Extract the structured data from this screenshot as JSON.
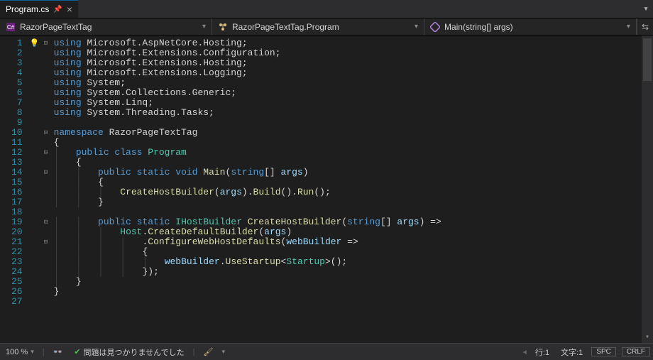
{
  "tab": {
    "name": "Program.cs"
  },
  "nav": {
    "project": "RazorPageTextTag",
    "class": "RazorPageTextTag.Program",
    "method": "Main(string[] args)"
  },
  "lines": {
    "count": 27,
    "bulb_line": 1,
    "folds": {
      "1": "⊟",
      "10": "⊟",
      "11": "",
      "12": "⊟",
      "13": "",
      "14": "⊟",
      "15": "",
      "19": "⊟",
      "21": "⊟"
    },
    "code": [
      {
        "indent": 0,
        "tokens": [
          {
            "t": "using ",
            "c": "kw"
          },
          {
            "t": "Microsoft.AspNetCore.Hosting;",
            "c": "ns"
          }
        ]
      },
      {
        "indent": 0,
        "tokens": [
          {
            "t": "using ",
            "c": "kw"
          },
          {
            "t": "Microsoft.Extensions.Configuration;",
            "c": "ns"
          }
        ]
      },
      {
        "indent": 0,
        "tokens": [
          {
            "t": "using ",
            "c": "kw"
          },
          {
            "t": "Microsoft.Extensions.Hosting;",
            "c": "ns"
          }
        ]
      },
      {
        "indent": 0,
        "tokens": [
          {
            "t": "using ",
            "c": "kw"
          },
          {
            "t": "Microsoft.Extensions.Logging;",
            "c": "ns"
          }
        ]
      },
      {
        "indent": 0,
        "tokens": [
          {
            "t": "using ",
            "c": "kw"
          },
          {
            "t": "System;",
            "c": "ns"
          }
        ]
      },
      {
        "indent": 0,
        "tokens": [
          {
            "t": "using ",
            "c": "kw"
          },
          {
            "t": "System.Collections.Generic;",
            "c": "ns"
          }
        ]
      },
      {
        "indent": 0,
        "tokens": [
          {
            "t": "using ",
            "c": "kw"
          },
          {
            "t": "System.Linq;",
            "c": "ns"
          }
        ]
      },
      {
        "indent": 0,
        "tokens": [
          {
            "t": "using ",
            "c": "kw"
          },
          {
            "t": "System.Threading.Tasks;",
            "c": "ns"
          }
        ]
      },
      {
        "indent": 0,
        "tokens": []
      },
      {
        "indent": 0,
        "tokens": [
          {
            "t": "namespace ",
            "c": "kw"
          },
          {
            "t": "RazorPageTextTag",
            "c": "ns"
          }
        ]
      },
      {
        "indent": 0,
        "tokens": [
          {
            "t": "{",
            "c": "punct"
          }
        ]
      },
      {
        "indent": 1,
        "tokens": [
          {
            "t": "public class ",
            "c": "kw"
          },
          {
            "t": "Program",
            "c": "type"
          }
        ]
      },
      {
        "indent": 1,
        "tokens": [
          {
            "t": "{",
            "c": "punct"
          }
        ]
      },
      {
        "indent": 2,
        "tokens": [
          {
            "t": "public static void ",
            "c": "kw"
          },
          {
            "t": "Main",
            "c": "method"
          },
          {
            "t": "(",
            "c": "punct"
          },
          {
            "t": "string",
            "c": "kw"
          },
          {
            "t": "[] ",
            "c": "punct"
          },
          {
            "t": "args",
            "c": "param"
          },
          {
            "t": ")",
            "c": "punct"
          }
        ]
      },
      {
        "indent": 2,
        "tokens": [
          {
            "t": "{",
            "c": "punct"
          }
        ]
      },
      {
        "indent": 3,
        "tokens": [
          {
            "t": "CreateHostBuilder",
            "c": "method"
          },
          {
            "t": "(",
            "c": "punct"
          },
          {
            "t": "args",
            "c": "param"
          },
          {
            "t": ").",
            "c": "punct"
          },
          {
            "t": "Build",
            "c": "method"
          },
          {
            "t": "().",
            "c": "punct"
          },
          {
            "t": "Run",
            "c": "method"
          },
          {
            "t": "();",
            "c": "punct"
          }
        ]
      },
      {
        "indent": 2,
        "tokens": [
          {
            "t": "}",
            "c": "punct"
          }
        ]
      },
      {
        "indent": 0,
        "tokens": []
      },
      {
        "indent": 2,
        "tokens": [
          {
            "t": "public static ",
            "c": "kw"
          },
          {
            "t": "IHostBuilder ",
            "c": "type"
          },
          {
            "t": "CreateHostBuilder",
            "c": "method"
          },
          {
            "t": "(",
            "c": "punct"
          },
          {
            "t": "string",
            "c": "kw"
          },
          {
            "t": "[] ",
            "c": "punct"
          },
          {
            "t": "args",
            "c": "param"
          },
          {
            "t": ") =>",
            "c": "punct"
          }
        ]
      },
      {
        "indent": 3,
        "tokens": [
          {
            "t": "Host",
            "c": "type"
          },
          {
            "t": ".",
            "c": "punct"
          },
          {
            "t": "CreateDefaultBuilder",
            "c": "method"
          },
          {
            "t": "(",
            "c": "punct"
          },
          {
            "t": "args",
            "c": "param"
          },
          {
            "t": ")",
            "c": "punct"
          }
        ]
      },
      {
        "indent": 4,
        "tokens": [
          {
            "t": ".",
            "c": "punct"
          },
          {
            "t": "ConfigureWebHostDefaults",
            "c": "method"
          },
          {
            "t": "(",
            "c": "punct"
          },
          {
            "t": "webBuilder ",
            "c": "param"
          },
          {
            "t": "=>",
            "c": "punct"
          }
        ]
      },
      {
        "indent": 4,
        "tokens": [
          {
            "t": "{",
            "c": "punct"
          }
        ]
      },
      {
        "indent": 5,
        "tokens": [
          {
            "t": "webBuilder",
            "c": "param"
          },
          {
            "t": ".",
            "c": "punct"
          },
          {
            "t": "UseStartup",
            "c": "method"
          },
          {
            "t": "<",
            "c": "punct"
          },
          {
            "t": "Startup",
            "c": "type"
          },
          {
            "t": ">();",
            "c": "punct"
          }
        ]
      },
      {
        "indent": 4,
        "tokens": [
          {
            "t": "});",
            "c": "punct"
          }
        ]
      },
      {
        "indent": 1,
        "tokens": [
          {
            "t": "}",
            "c": "punct"
          }
        ]
      },
      {
        "indent": 0,
        "tokens": [
          {
            "t": "}",
            "c": "punct"
          }
        ]
      },
      {
        "indent": 0,
        "tokens": []
      }
    ]
  },
  "status": {
    "zoom": "100 %",
    "issues": "問題は見つかりませんでした",
    "line": "行:1",
    "col": "文字:1",
    "spaces": "SPC",
    "eol": "CRLF"
  }
}
